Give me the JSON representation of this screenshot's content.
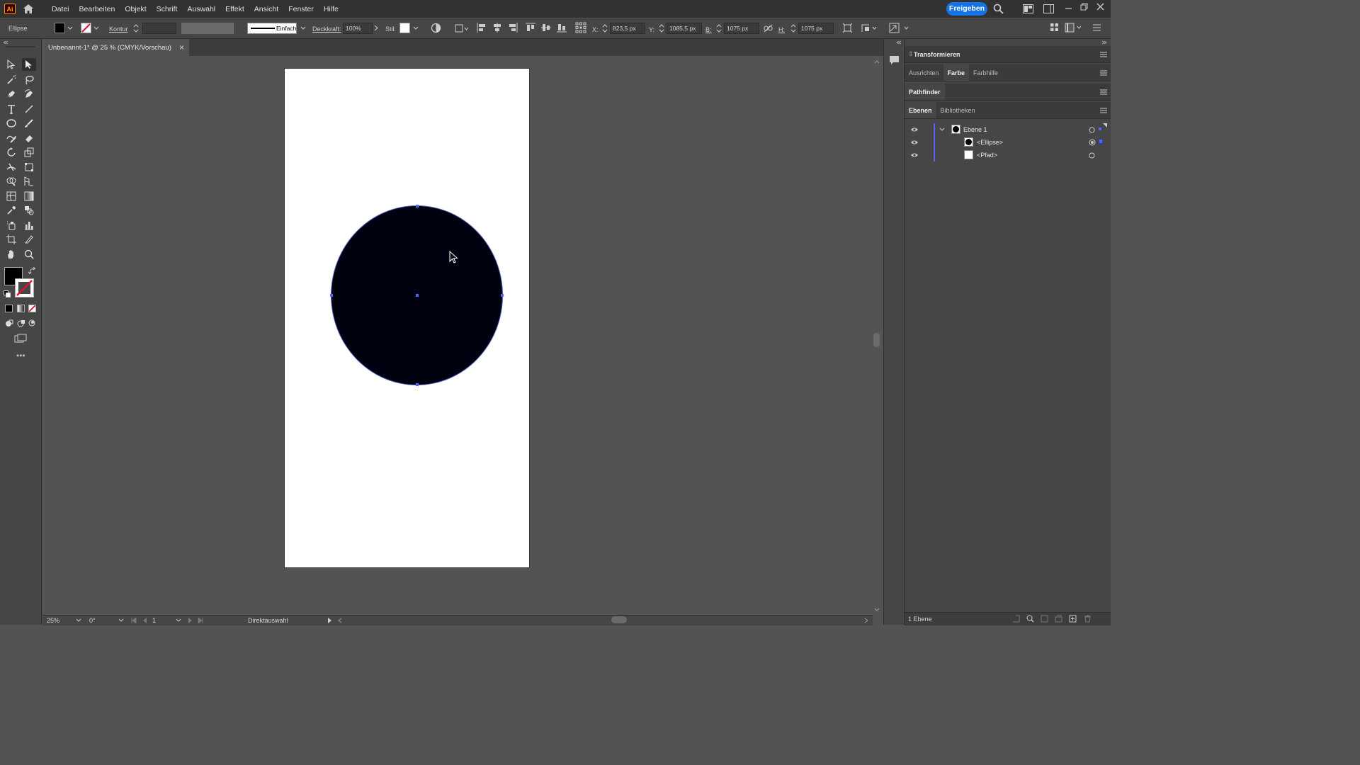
{
  "app": {
    "logo_text": "Ai",
    "menu": [
      "Datei",
      "Bearbeiten",
      "Objekt",
      "Schrift",
      "Auswahl",
      "Effekt",
      "Ansicht",
      "Fenster",
      "Hilfe"
    ],
    "share_label": "Freigeben"
  },
  "control_bar": {
    "selection_label": "Ellipse",
    "stroke_label": "Kontur",
    "stroke_style": "Einfach",
    "opacity_label": "Deckkraft:",
    "opacity_value": "100%",
    "style_label": "Stil:",
    "x_label": "X:",
    "x_value": "823,5 px",
    "y_label": "Y:",
    "y_value": "1085,5 px",
    "w_label": "B:",
    "w_value": "1075 px",
    "h_label": "H:",
    "h_value": "1075 px"
  },
  "document_tab": {
    "title": "Unbenannt-1* @ 25 % (CMYK/Vorschau)",
    "close_glyph": "×"
  },
  "canvas": {
    "fill_color": "#000210",
    "selection_color": "#4f67ff"
  },
  "panels": {
    "transform_title": "Transformieren",
    "color_tabs": [
      "Ausrichten",
      "Farbe",
      "Farbhilfe"
    ],
    "pathfinder_title": "Pathfinder",
    "layer_tabs": [
      "Ebenen",
      "Bibliotheken"
    ],
    "layers": [
      {
        "name": "Ebene 1"
      },
      {
        "name": "<Ellipse>"
      },
      {
        "name": "<Pfad>"
      }
    ],
    "layer_count": "1 Ebene"
  },
  "status_bar": {
    "zoom": "25%",
    "rotation": "0°",
    "artboard_num": "1",
    "tool_name": "Direktauswahl"
  }
}
